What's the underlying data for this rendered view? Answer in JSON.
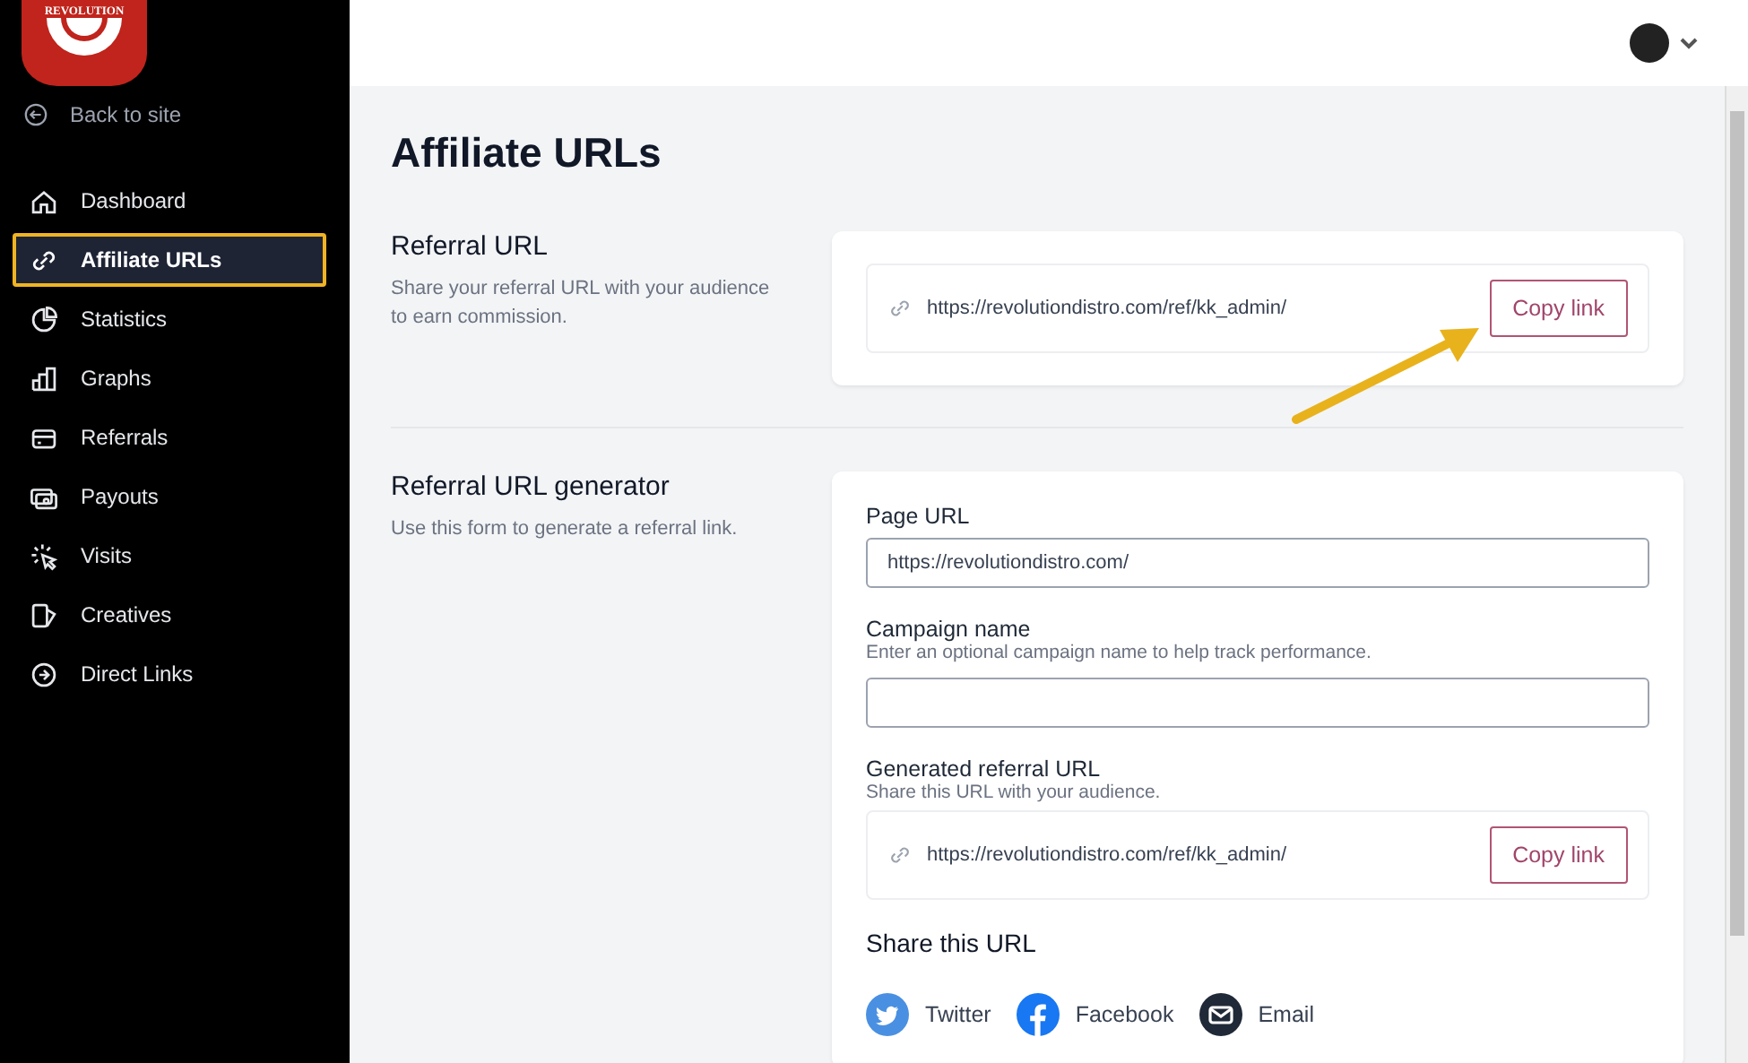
{
  "logo": {
    "text": "REVOLUTION"
  },
  "back_link": {
    "label": "Back to site"
  },
  "sidebar": {
    "items": [
      {
        "label": "Dashboard",
        "kind": "home",
        "selected": false
      },
      {
        "label": "Affiliate URLs",
        "kind": "link",
        "selected": true
      },
      {
        "label": "Statistics",
        "kind": "pie",
        "selected": false
      },
      {
        "label": "Graphs",
        "kind": "bars",
        "selected": false
      },
      {
        "label": "Referrals",
        "kind": "card",
        "selected": false
      },
      {
        "label": "Payouts",
        "kind": "cash",
        "selected": false
      },
      {
        "label": "Visits",
        "kind": "cursor",
        "selected": false
      },
      {
        "label": "Creatives",
        "kind": "creative",
        "selected": false
      },
      {
        "label": "Direct Links",
        "kind": "arrow",
        "selected": false
      }
    ]
  },
  "page_title": "Affiliate URLs",
  "referral_url": {
    "title": "Referral URL",
    "description": "Share your referral URL with your audience to earn commission.",
    "url": "https://revolutiondistro.com/ref/kk_admin/",
    "button": "Copy link"
  },
  "generator": {
    "title": "Referral URL generator",
    "description": "Use this form to generate a referral link.",
    "page_url": {
      "label": "Page URL",
      "value": "https://revolutiondistro.com/"
    },
    "campaign_name": {
      "label": "Campaign name",
      "hint": "Enter an optional campaign name to help track performance."
    },
    "generated": {
      "label": "Generated referral URL",
      "hint": "Share this URL with your audience.",
      "url": "https://revolutiondistro.com/ref/kk_admin/",
      "button": "Copy link"
    },
    "share": {
      "title": "Share this URL",
      "items": [
        {
          "kind": "twitter",
          "label": "Twitter"
        },
        {
          "kind": "facebook",
          "label": "Facebook"
        },
        {
          "kind": "email",
          "label": "Email"
        }
      ]
    }
  }
}
